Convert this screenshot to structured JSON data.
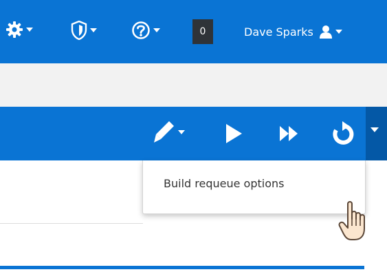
{
  "topbar": {
    "settings_menu": {
      "icon": "gear-icon"
    },
    "security_menu": {
      "icon": "shield-icon"
    },
    "help_menu": {
      "icon": "help-circle-icon"
    },
    "notification_count": "0",
    "user": {
      "name": "Dave Sparks",
      "icon": "user-icon"
    }
  },
  "actionbar": {
    "edit": {
      "icon": "pencil-icon"
    },
    "run": {
      "icon": "play-icon"
    },
    "fast_forward": {
      "icon": "fast-forward-icon"
    },
    "requeue": {
      "icon": "refresh-icon"
    }
  },
  "requeue_dropdown": {
    "items": [
      {
        "label": "Build requeue options"
      }
    ]
  },
  "progress": {
    "fraction": 1.0
  },
  "colors": {
    "primary": "#0a74d4",
    "primary_dark": "#0458a6",
    "counter_bg": "#2f3338",
    "subbar_bg": "#f2f2f2"
  }
}
